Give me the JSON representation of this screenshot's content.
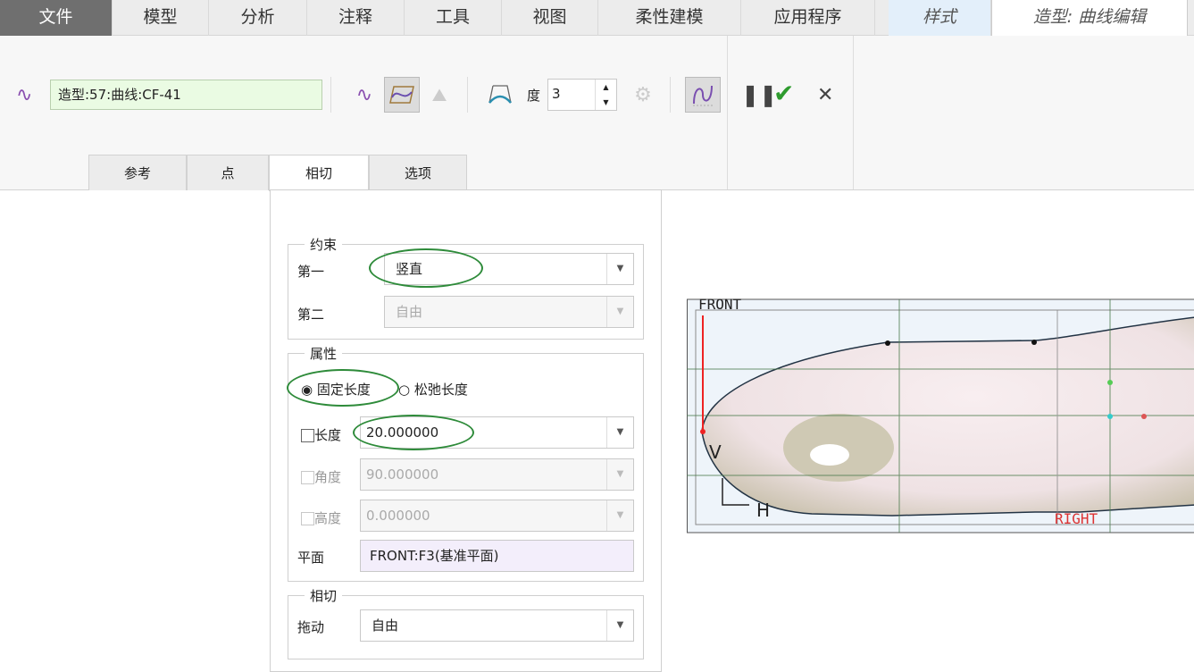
{
  "top_tabs": [
    "文件",
    "模型",
    "分析",
    "注释",
    "工具",
    "视图",
    "柔性建模",
    "应用程序",
    "样式",
    "造型: 曲线编辑"
  ],
  "ribbon": {
    "curve_name": "造型:57:曲线:CF-41",
    "degree_label": "度",
    "degree_value": "3"
  },
  "sub_tabs": [
    "参考",
    "点",
    "相切",
    "选项"
  ],
  "panel": {
    "constraint": {
      "legend": "约束",
      "first_label": "第一",
      "first_value": "竖直",
      "second_label": "第二",
      "second_value": "自由"
    },
    "properties": {
      "legend": "属性",
      "radio_fixed": "固定长度",
      "radio_relaxed": "松弛长度",
      "length_label": "长度",
      "length_value": "20.000000",
      "angle_label": "角度",
      "angle_value": "90.000000",
      "height_label": "高度",
      "height_value": "0.000000",
      "plane_label": "平面",
      "plane_value": "FRONT:F3(基准平面)"
    },
    "tangent": {
      "legend": "相切",
      "drag_label": "拖动",
      "drag_value": "自由"
    }
  },
  "viewport": {
    "front_label": "FRONT",
    "right_label": "RIGHT",
    "v_label": "V",
    "h_label": "H"
  },
  "colors": {
    "accent_green": "#2e8b3a",
    "curve_purple": "#8a4fb0"
  }
}
